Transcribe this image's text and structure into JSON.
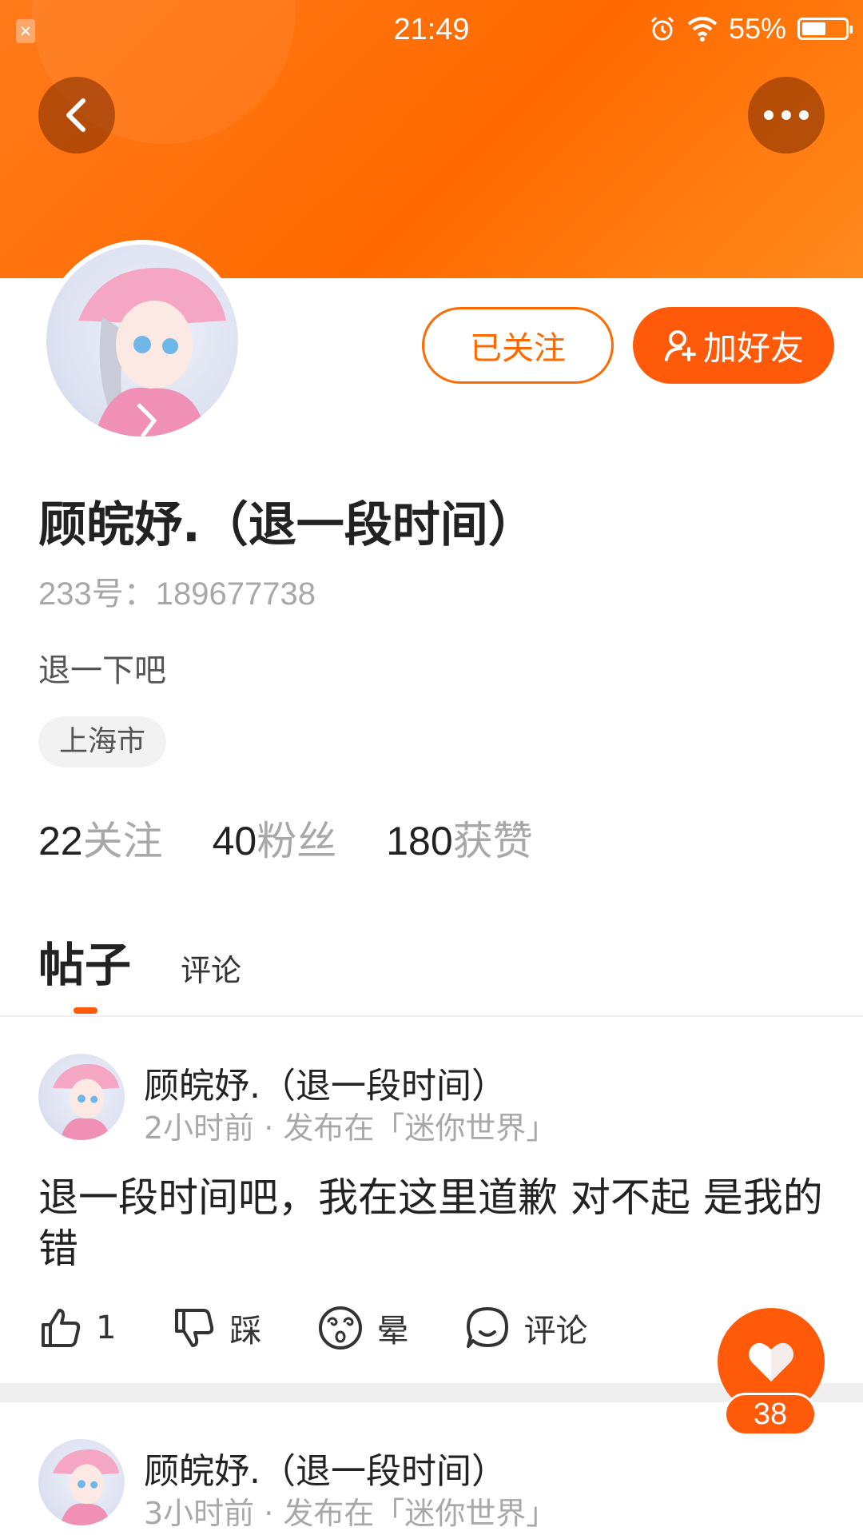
{
  "status_bar": {
    "time": "21:49",
    "battery": "55%",
    "battery_level": 0.55
  },
  "colors": {
    "accent": "#ff5a0a",
    "header_start": "#ff7a1a",
    "header_end": "#ff8a1e"
  },
  "profile": {
    "name": "顾皖妤.（退一段时间）",
    "id_text": "233号：189677738",
    "bio": "退一下吧",
    "location": "上海市",
    "follow_state_label": "已关注",
    "add_friend_label": "加好友"
  },
  "stats": [
    {
      "num": "22",
      "label": "关注"
    },
    {
      "num": "40",
      "label": "粉丝"
    },
    {
      "num": "180",
      "label": "获赞"
    }
  ],
  "tabs": {
    "posts": "帖子",
    "comments": "评论"
  },
  "posts": [
    {
      "author": "顾皖妤.（退一段时间）",
      "meta": "2小时前 · 发布在「迷你世界」",
      "text": "退一段时间吧，我在这里道歉 对不起 是我的错",
      "actions": {
        "like": "1",
        "dislike": "踩",
        "dizzy": "晕",
        "comment": "评论"
      }
    },
    {
      "author": "顾皖妤.（退一段时间）",
      "meta": "3小时前 · 发布在「迷你世界」"
    }
  ],
  "fab": {
    "count": "38"
  },
  "icons": [
    "back-icon",
    "more-icon",
    "add-user-icon",
    "thumbs-up-icon",
    "thumbs-down-icon",
    "dizzy-face-icon",
    "comment-icon",
    "heart-icon",
    "alarm-icon",
    "wifi-icon",
    "battery-icon"
  ]
}
